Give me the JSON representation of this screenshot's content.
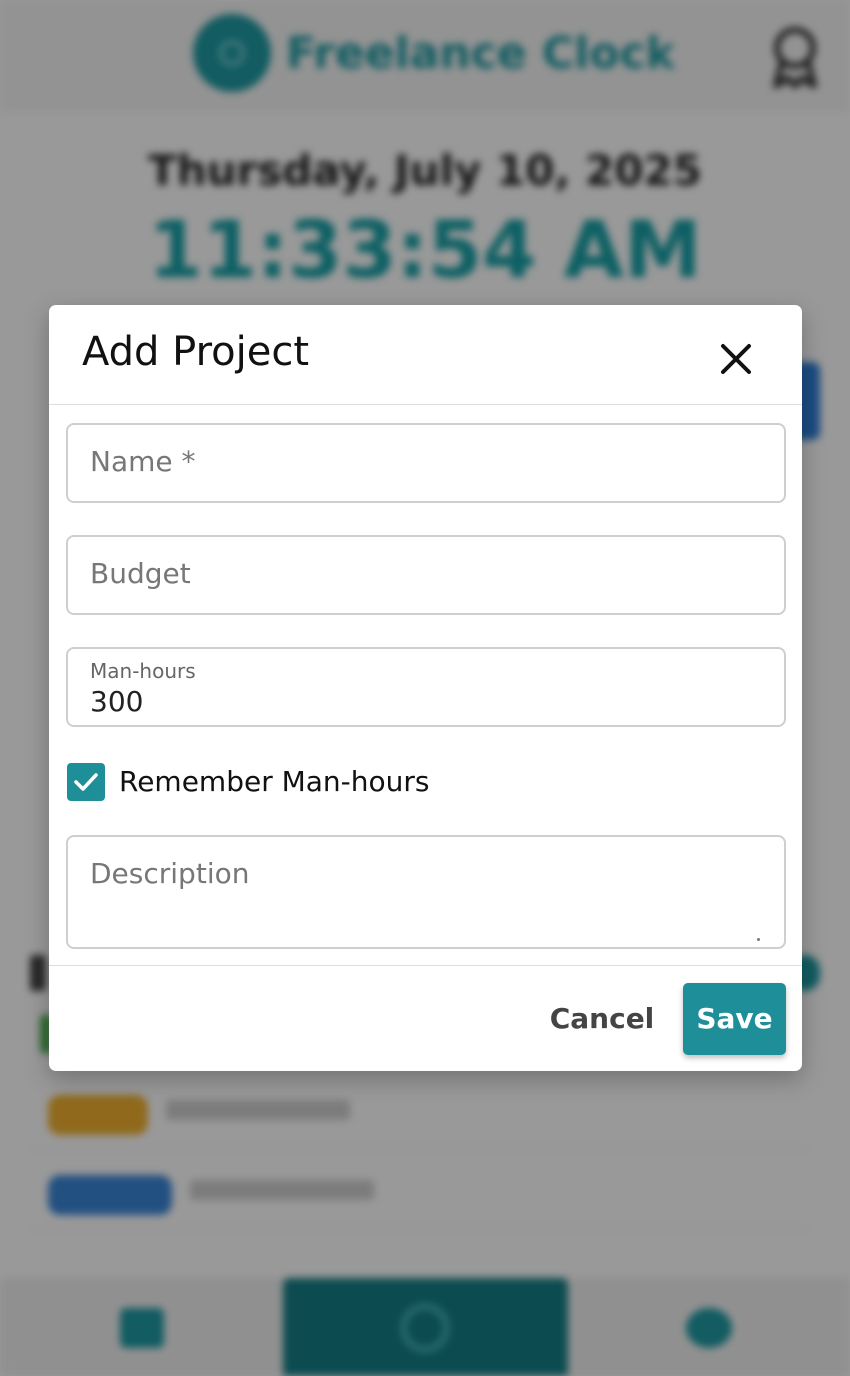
{
  "background_app": {
    "brand_name": "Freelance Clock",
    "date": "Thursday, July 10, 2025",
    "time": "11:33:54 AM"
  },
  "modal": {
    "title": "Add Project",
    "fields": {
      "name": {
        "placeholder": "Name *",
        "value": ""
      },
      "budget": {
        "placeholder": "Budget",
        "value": ""
      },
      "man_hours": {
        "label": "Man-hours",
        "value": "300"
      },
      "description": {
        "placeholder": "Description",
        "value": ""
      }
    },
    "remember_checkbox": {
      "label": "Remember Man-hours",
      "checked": true
    },
    "cancel_label": "Cancel",
    "save_label": "Save"
  },
  "colors": {
    "accent": "#1e8f98",
    "brand": "#1e9aa3",
    "scrim": "rgba(0,0,0,0.40)"
  },
  "icons": {
    "close": "close-icon",
    "check": "checkmark-icon",
    "award": "award-icon"
  }
}
